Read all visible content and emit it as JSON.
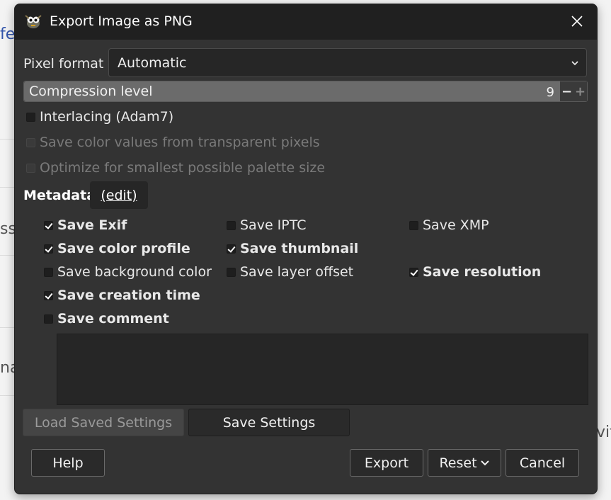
{
  "background": {
    "fragments": [
      "fe",
      "ss",
      "na",
      "vit"
    ]
  },
  "dialog": {
    "title": "Export Image as PNG",
    "pixel_format": {
      "label": "Pixel format",
      "value": "Automatic"
    },
    "compression": {
      "label": "Compression level",
      "value": "9",
      "fraction": 1.0,
      "minus": "−",
      "plus": "+"
    },
    "options": [
      {
        "label": "Interlacing (Adam7)",
        "checked": false,
        "enabled": true
      },
      {
        "label": "Save color values from transparent pixels",
        "checked": false,
        "enabled": false
      },
      {
        "label": "Optimize for smallest possible palette size",
        "checked": false,
        "enabled": false
      }
    ],
    "metadata": {
      "label": "Metadata",
      "edit_label": "(edit)",
      "items": [
        {
          "label": "Save Exif",
          "checked": true
        },
        {
          "label": "Save IPTC",
          "checked": false
        },
        {
          "label": "Save XMP",
          "checked": false
        },
        {
          "label": "Save color profile",
          "checked": true
        },
        {
          "label": "Save thumbnail",
          "checked": true
        },
        {
          "label": "Save background color",
          "checked": false
        },
        {
          "label": "Save layer offset",
          "checked": false
        },
        {
          "label": "Save resolution",
          "checked": true
        },
        {
          "label": "Save creation time",
          "checked": true
        },
        {
          "label": "Save comment",
          "checked": false
        }
      ],
      "comment_value": ""
    },
    "buttons": {
      "load_saved": "Load Saved Settings",
      "save_settings": "Save Settings",
      "help": "Help",
      "export": "Export",
      "reset": "Reset",
      "cancel": "Cancel"
    }
  },
  "colors": {
    "dialog_bg": "#333333",
    "titlebar_bg": "#202020",
    "field_bg": "#262626"
  }
}
